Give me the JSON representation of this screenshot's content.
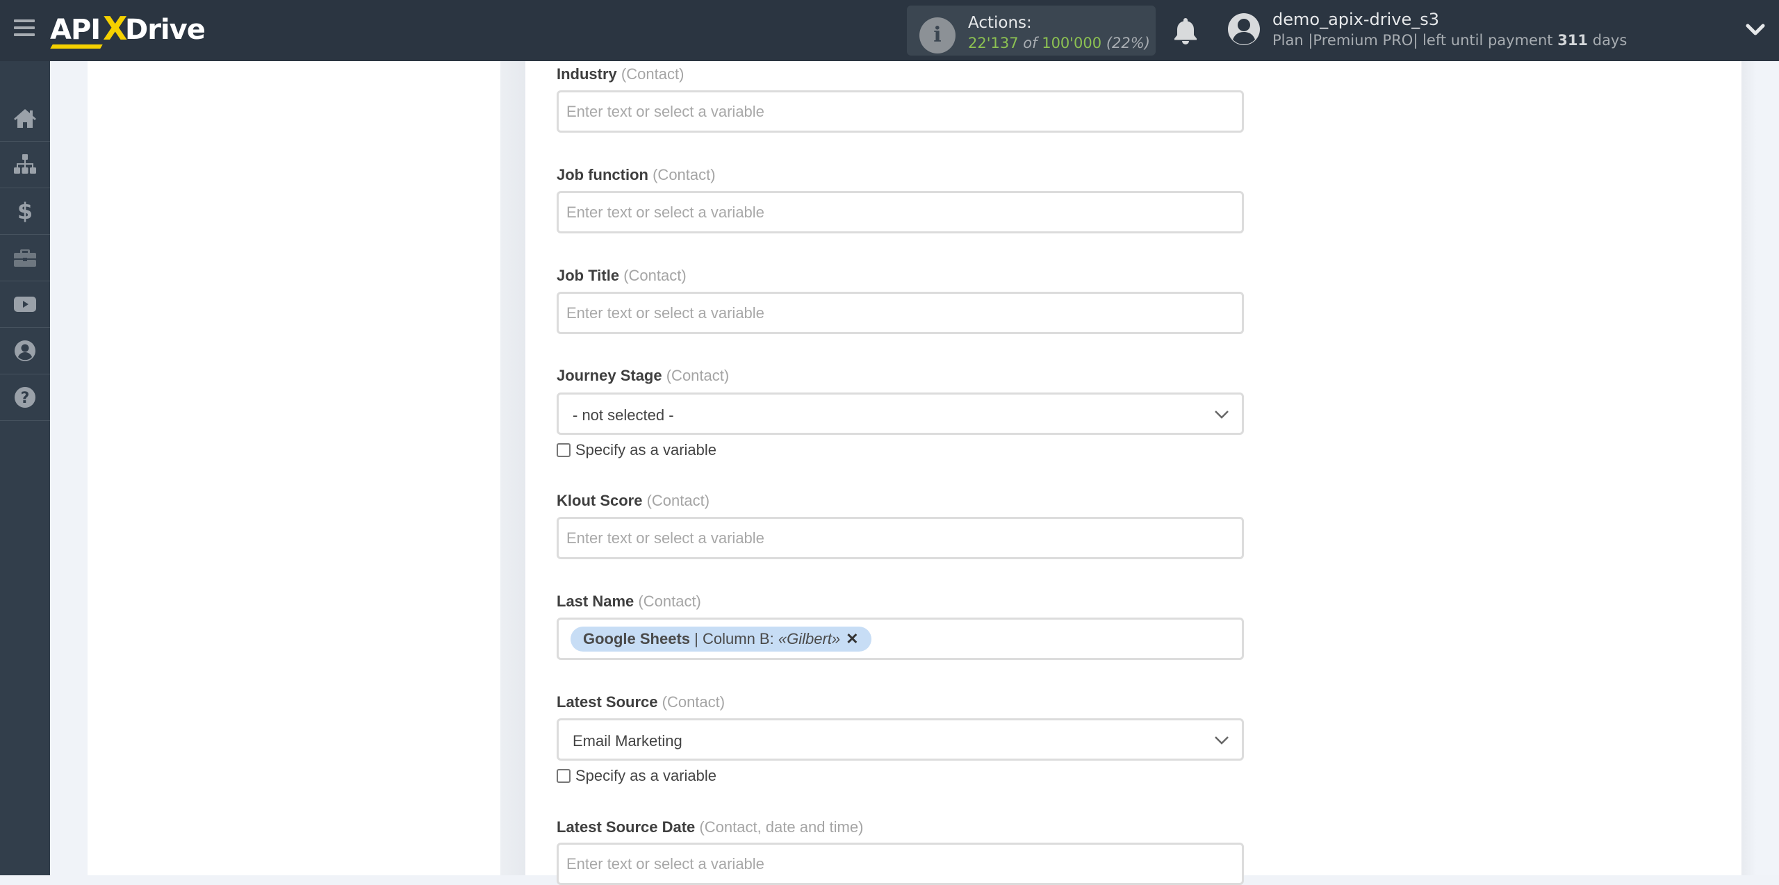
{
  "header": {
    "logo": {
      "part1": "API",
      "part2": "X",
      "part3": "Drive"
    },
    "actions": {
      "label": "Actions:",
      "used": "22'137",
      "of": "of",
      "total": "100'000",
      "percent": "(22%)"
    },
    "user": {
      "name": "demo_apix-drive_s3",
      "plan_prefix": "Plan |Premium PRO| left until payment",
      "days": "311",
      "days_suffix": "days"
    }
  },
  "sidebar": {
    "items": [
      {
        "icon": "home-icon"
      },
      {
        "icon": "sitemap-icon"
      },
      {
        "icon": "dollar-icon"
      },
      {
        "icon": "briefcase-icon"
      },
      {
        "icon": "youtube-icon"
      },
      {
        "icon": "user-circle-icon"
      },
      {
        "icon": "help-icon"
      }
    ]
  },
  "form": {
    "fields": [
      {
        "label": "Industry",
        "hint": "(Contact)",
        "type": "text",
        "placeholder": "Enter text or select a variable",
        "value": ""
      },
      {
        "label": "Job function",
        "hint": "(Contact)",
        "type": "text",
        "placeholder": "Enter text or select a variable",
        "value": ""
      },
      {
        "label": "Job Title",
        "hint": "(Contact)",
        "type": "text",
        "placeholder": "Enter text or select a variable",
        "value": ""
      },
      {
        "label": "Journey Stage",
        "hint": "(Contact)",
        "type": "select",
        "selected": "- not selected -",
        "checkbox_label": "Specify as a variable",
        "checked": false
      },
      {
        "label": "Klout Score",
        "hint": "(Contact)",
        "type": "text",
        "placeholder": "Enter text or select a variable",
        "value": ""
      },
      {
        "label": "Last Name",
        "hint": "(Contact)",
        "type": "tag",
        "tag": {
          "source": "Google Sheets",
          "separator": "|",
          "column": "Column B:",
          "value": "«Gilbert»"
        }
      },
      {
        "label": "Latest Source",
        "hint": "(Contact)",
        "type": "select",
        "selected": "Email Marketing",
        "checkbox_label": "Specify as a variable",
        "checked": false
      },
      {
        "label": "Latest Source Date",
        "hint": "(Contact, date and time)",
        "type": "text",
        "placeholder": "Enter text or select a variable",
        "value": ""
      }
    ]
  },
  "colors": {
    "header_bg": "#2b3541",
    "sidebar_bg": "#323e4b",
    "accent_yellow": "#f5d100",
    "actions_green": "#8cc152",
    "tag_bg": "#c7ddf5"
  }
}
